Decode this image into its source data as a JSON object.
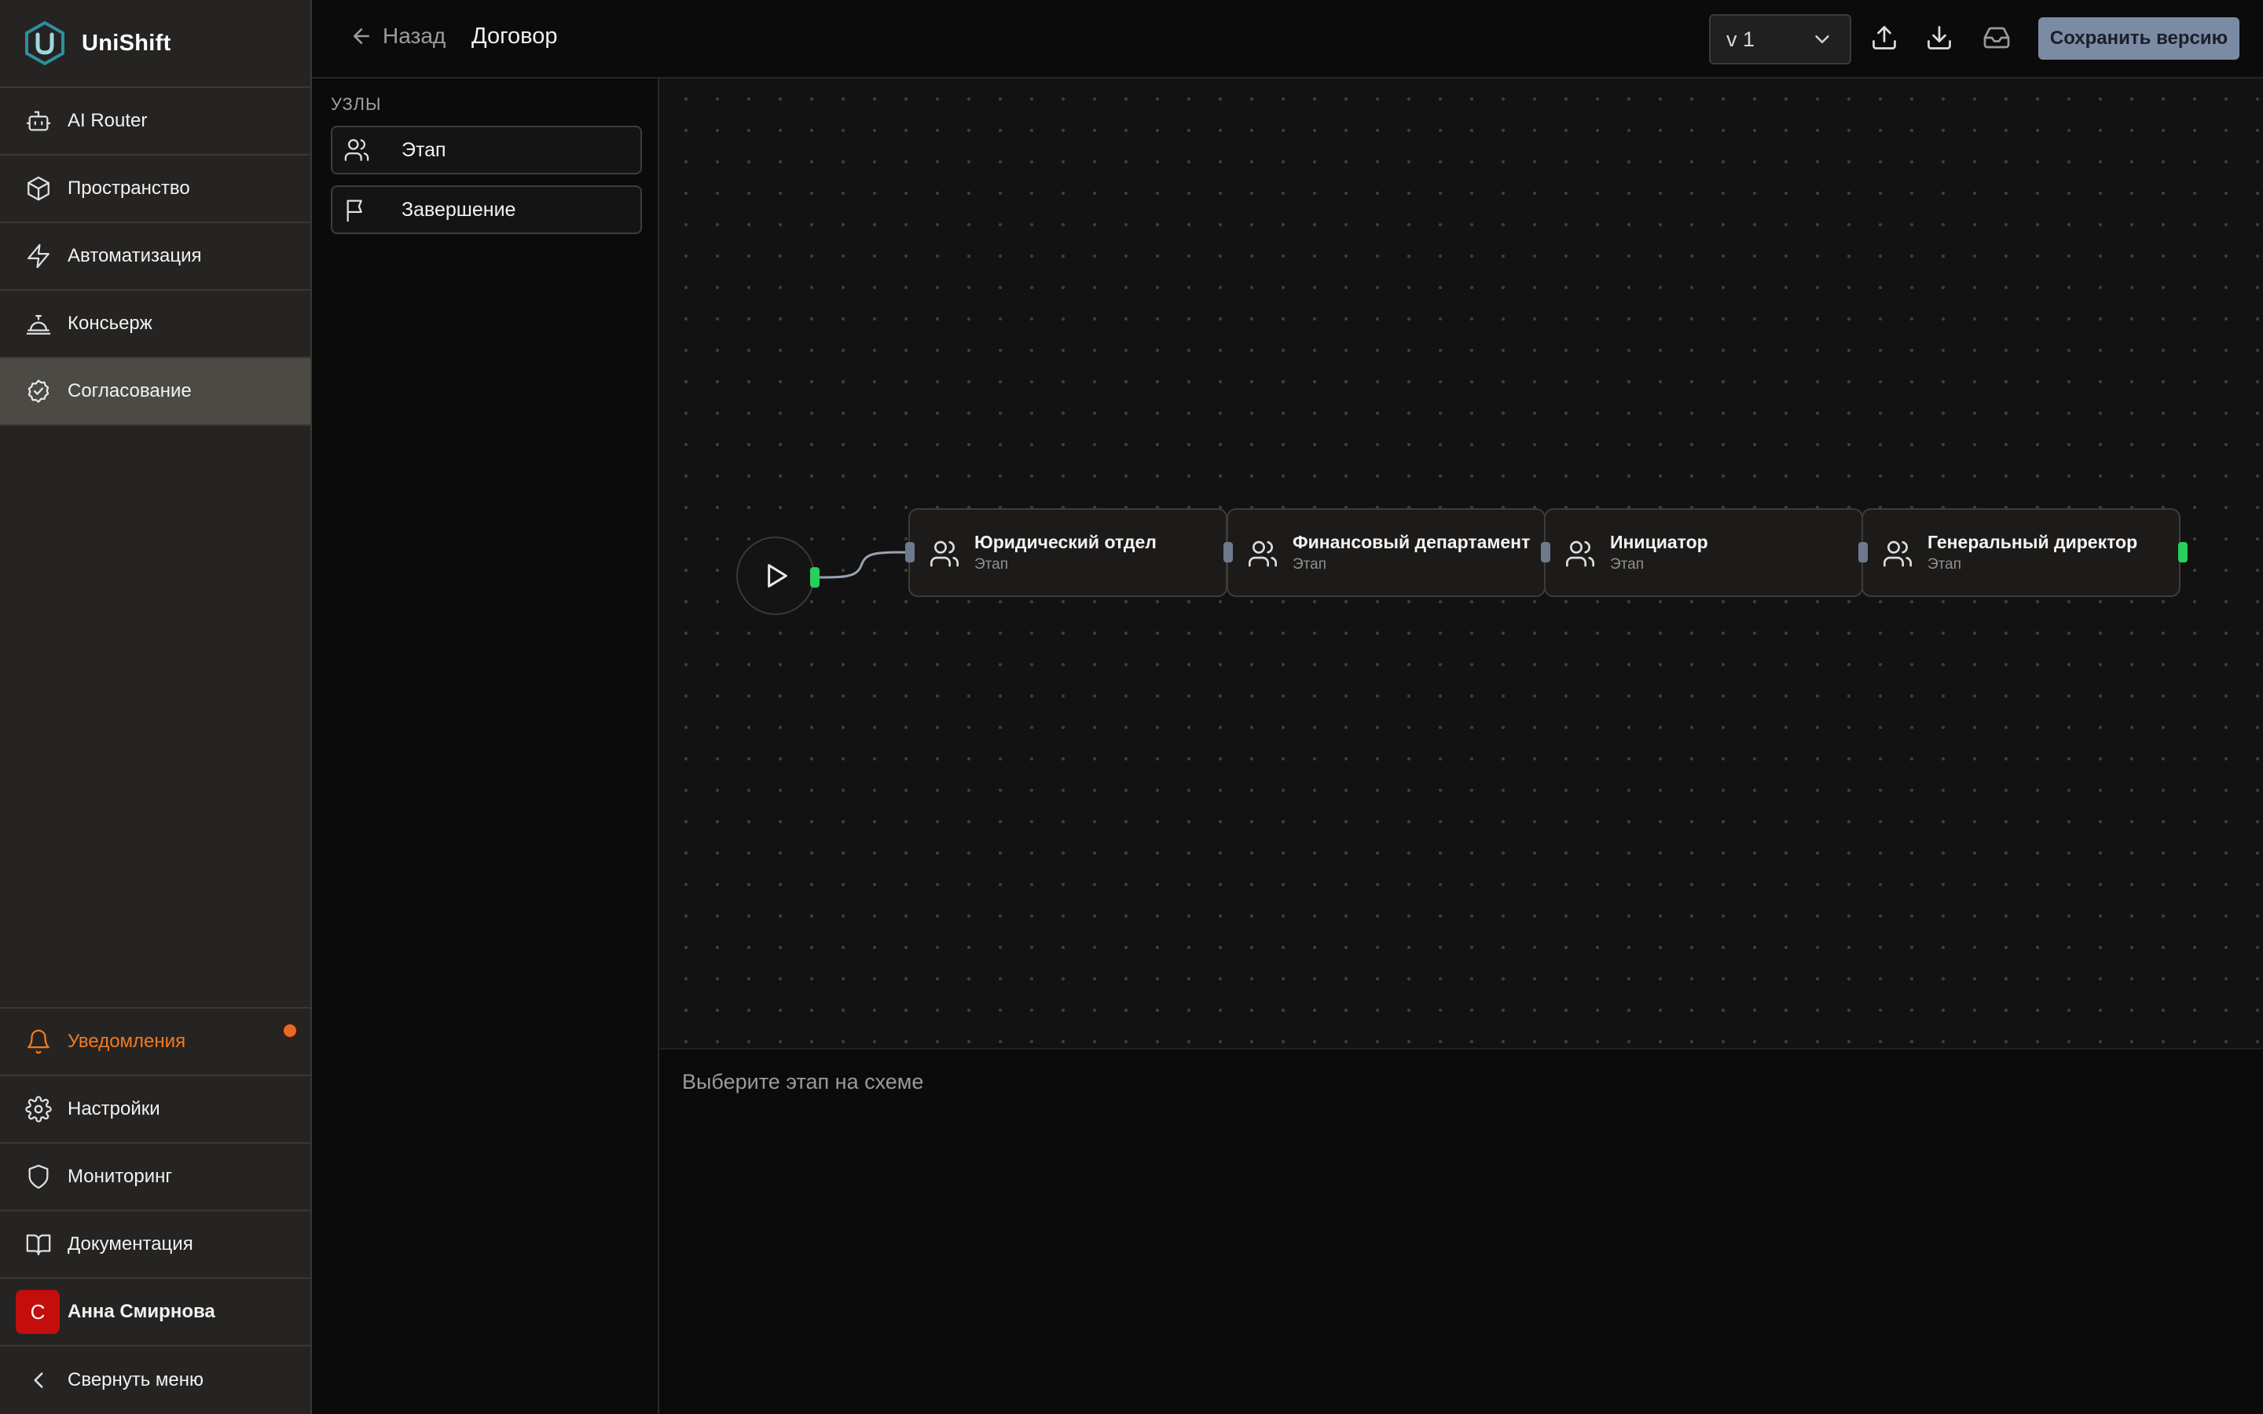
{
  "app": {
    "name": "UniShift",
    "brand_color": "#2e8fa0"
  },
  "sidebar": {
    "items": [
      {
        "label": "AI Router",
        "icon": "bot-icon"
      },
      {
        "label": "Пространство",
        "icon": "box-icon"
      },
      {
        "label": "Автоматизация",
        "icon": "zap-icon"
      },
      {
        "label": "Консьерж",
        "icon": "concierge-bell-icon"
      },
      {
        "label": "Согласование",
        "icon": "check-circle-icon",
        "active": true
      }
    ],
    "bottom_items": [
      {
        "label": "Уведомления",
        "icon": "bell-icon",
        "badge_color": "#e7692a"
      },
      {
        "label": "Настройки",
        "icon": "gear-icon"
      },
      {
        "label": "Мониторинг",
        "icon": "shield-icon"
      },
      {
        "label": "Документация",
        "icon": "book-open-icon"
      }
    ],
    "user": {
      "initial": "С",
      "name": "Анна Смирнова"
    },
    "collapse_label": "Свернуть меню"
  },
  "header": {
    "back_label": "Назад",
    "title": "Договор",
    "version": "v 1",
    "icons": [
      "upload-icon",
      "download-icon",
      "inbox-icon"
    ],
    "save_label": "Сохранить версию"
  },
  "palette": {
    "title": "УЗЛЫ",
    "items": [
      {
        "label": "Этап",
        "icon": "users-icon"
      },
      {
        "label": "Завершение",
        "icon": "flag-icon"
      }
    ]
  },
  "flow": {
    "start_icon": "play-icon",
    "stages": [
      {
        "title": "Юридический отдел",
        "subtitle": "Этап"
      },
      {
        "title": "Финансовый департамент",
        "subtitle": "Этап"
      },
      {
        "title": "Инициатор",
        "subtitle": "Этап"
      },
      {
        "title": "Генеральный директор",
        "subtitle": "Этап"
      }
    ]
  },
  "details": {
    "hint": "Выберите этап на схеме"
  }
}
